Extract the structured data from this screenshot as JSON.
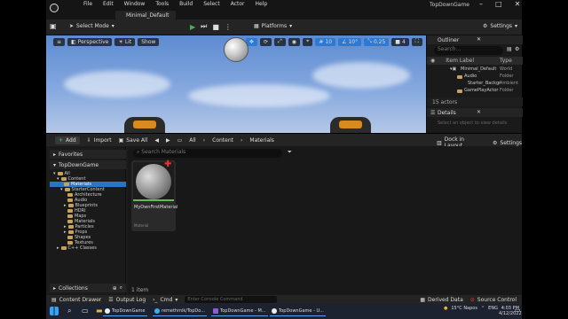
{
  "app": {
    "menus": [
      "File",
      "Edit",
      "Window",
      "Tools",
      "Build",
      "Select",
      "Actor",
      "Help"
    ],
    "project_tab": "Minimal_Default",
    "window_title": "TopDownGame"
  },
  "toolbar": {
    "mode_label": "Select Mode",
    "platforms_label": "Platforms",
    "settings_label": "Settings"
  },
  "viewport": {
    "perspective_label": "Perspective",
    "lit_label": "Lit",
    "show_label": "Show",
    "grid_snap": "10",
    "rot_snap": "10°",
    "scale_snap": "0.25",
    "cam_speed": "4"
  },
  "outliner": {
    "title": "Outliner",
    "search_placeholder": "Search...",
    "col_label": "Item Label",
    "col_type": "Type",
    "rows": [
      {
        "label": "Minimal_Default",
        "type": "World"
      },
      {
        "label": "Audio",
        "type": "Folder"
      },
      {
        "label": "Starter_Backgr",
        "type": "Ambient"
      },
      {
        "label": "GamePlayActor",
        "type": "Folder"
      }
    ],
    "count": "15 actors"
  },
  "details": {
    "title": "Details",
    "hint": "Select an object to view details"
  },
  "content_browser": {
    "add_label": "Add",
    "import_label": "Import",
    "save_all_label": "Save All",
    "path": [
      "All",
      "Content",
      "Materials"
    ],
    "dock_label": "Dock in Layout",
    "settings_label": "Settings",
    "favorites_label": "Favorites",
    "project_label": "TopDownGame",
    "tree": [
      {
        "label": "All",
        "depth": 0
      },
      {
        "label": "Content",
        "depth": 1
      },
      {
        "label": "Materials",
        "depth": 2,
        "selected": true
      },
      {
        "label": "StarterContent",
        "depth": 2
      },
      {
        "label": "Architecture",
        "depth": 3
      },
      {
        "label": "Audio",
        "depth": 3
      },
      {
        "label": "Blueprints",
        "depth": 3
      },
      {
        "label": "HDRI",
        "depth": 3
      },
      {
        "label": "Maps",
        "depth": 3
      },
      {
        "label": "Materials",
        "depth": 3
      },
      {
        "label": "Particles",
        "depth": 3
      },
      {
        "label": "Props",
        "depth": 3
      },
      {
        "label": "Shapes",
        "depth": 3
      },
      {
        "label": "Textures",
        "depth": 3
      },
      {
        "label": "C++ Classes",
        "depth": 1
      }
    ],
    "collections_label": "Collections",
    "search_placeholder": "Search Materials",
    "asset": {
      "name": "MyOwnFirstMaterial",
      "kind": "Material"
    },
    "status": "1 item"
  },
  "bottom_bar": {
    "content_drawer": "Content Drawer",
    "output_log": "Output Log",
    "cmd": "Cmd",
    "console_placeholder": "Enter Console Command",
    "derived_data": "Derived Data",
    "source_control": "Source Control"
  },
  "taskbar": {
    "items": [
      "TopDownGame",
      "remethmik/TopDo...",
      "TopDownGame - M...",
      "TopDownGame - U..."
    ],
    "weather": "15°C Napos",
    "lang": "ENG",
    "time": "4:03 PM",
    "date": "4/12/2022"
  },
  "colors": {
    "accent": "#2a76c6",
    "folder": "#c7a25b",
    "material_bar": "#61bd4f",
    "play_green": "#4caf50"
  }
}
